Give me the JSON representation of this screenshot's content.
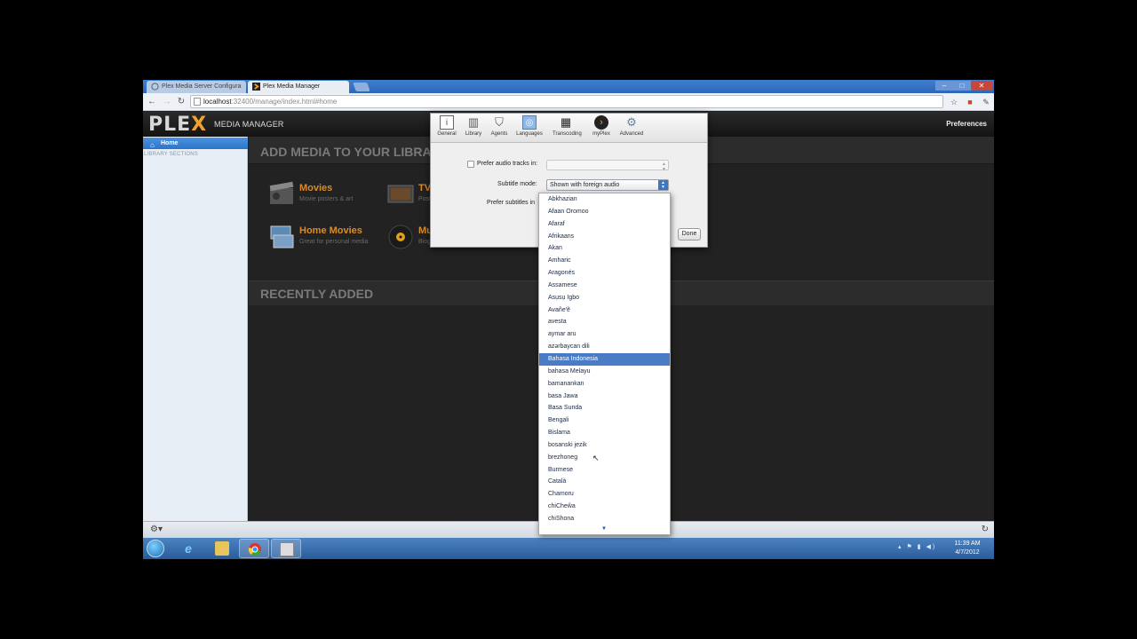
{
  "browser": {
    "tabs": [
      {
        "label": "Plex Media Server Configura"
      },
      {
        "label": "Plex Media Manager"
      }
    ],
    "url_host": "localhost",
    "url_path": ":32400/manage/index.html#home"
  },
  "header": {
    "logo_main": "PLE",
    "logo_x": "X",
    "title": "MEDIA MANAGER",
    "preferences": "Preferences"
  },
  "sidebar": {
    "home": "Home",
    "sections_label": "LIBRARY SECTIONS"
  },
  "main": {
    "add_media_title": "ADD MEDIA TO YOUR LIBRARY",
    "media_types": [
      {
        "title": "Movies",
        "subtitle": "Movie posters & art"
      },
      {
        "title": "TV Shows",
        "subtitle": "Posters & episode art"
      },
      {
        "title": "Home Movies",
        "subtitle": "Great for personal media"
      },
      {
        "title": "Music",
        "subtitle": "Biographies & reviews"
      }
    ],
    "recent_title": "RECENTLY ADDED"
  },
  "prefs": {
    "tabs": [
      {
        "label": "General",
        "icon": "info-icon"
      },
      {
        "label": "Library",
        "icon": "library-icon"
      },
      {
        "label": "Agents",
        "icon": "shield-icon"
      },
      {
        "label": "Languages",
        "icon": "globe-icon"
      },
      {
        "label": "Transcoding",
        "icon": "clapper-icon"
      },
      {
        "label": "myPlex",
        "icon": "plex-chevron-icon"
      },
      {
        "label": "Advanced",
        "icon": "gear-icon"
      }
    ],
    "audio_label": "Prefer audio tracks in:",
    "audio_value": "",
    "subtitle_label": "Subtitle mode:",
    "subtitle_value": "Shown with foreign audio",
    "prefer_subs_label": "Prefer subtitles in",
    "done": "Done"
  },
  "languages": {
    "selected_index": 13,
    "items": [
      "Abkhazian",
      "Afaan Oromoo",
      "Afaraf",
      "Afrikaans",
      "Akan",
      "Amharic",
      "Aragonés",
      "Assamese",
      "Asụsụ Igbo",
      "Avañe'ẽ",
      "avesta",
      "aymar aru",
      "azərbaycan dili",
      "Bahasa Indonesia",
      "bahasa Melayu",
      "bamanankan",
      "basa Jawa",
      "Basa Sunda",
      "Bengali",
      "Bislama",
      "bosanski jezik",
      "brezhoneg",
      "Burmese",
      "Català",
      "Chamoru",
      "chiCheŵa",
      "chiShona"
    ]
  },
  "taskbar": {
    "time": "11:39 AM",
    "date": "4/7/2012"
  }
}
